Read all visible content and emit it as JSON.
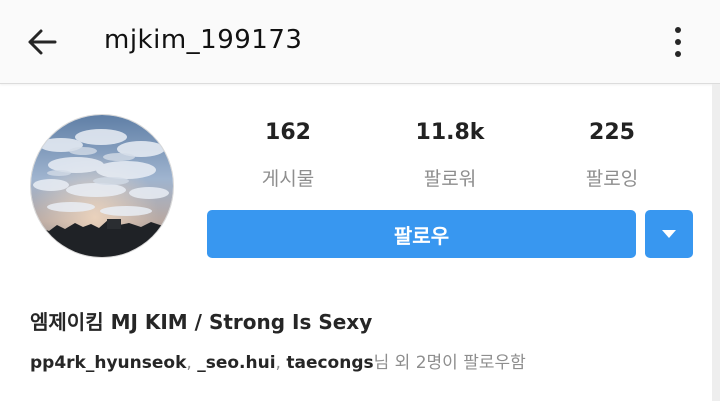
{
  "header": {
    "username": "mjkim_199173",
    "back_icon": "arrow-left-icon",
    "more_icon": "more-vertical-icon"
  },
  "profile": {
    "avatar": "sky-clouds-photo",
    "stats": [
      {
        "value": "162",
        "label": "게시물"
      },
      {
        "value": "11.8k",
        "label": "팔로워"
      },
      {
        "value": "225",
        "label": "팔로잉"
      }
    ],
    "follow_button_label": "팔로우",
    "dropdown_icon": "caret-down-icon",
    "full_name": "엠제이킴 MJ KIM / Strong Is Sexy",
    "followed_by": {
      "users": [
        "pp4rk_hyunseok",
        "_seo.hui",
        "taecongs"
      ],
      "separator": ", ",
      "suffix": "님 외 2명이 팔로우함"
    }
  },
  "colors": {
    "accent": "#3897f0",
    "muted_text": "#8e8e8e",
    "app_bar": "#fafafa"
  }
}
